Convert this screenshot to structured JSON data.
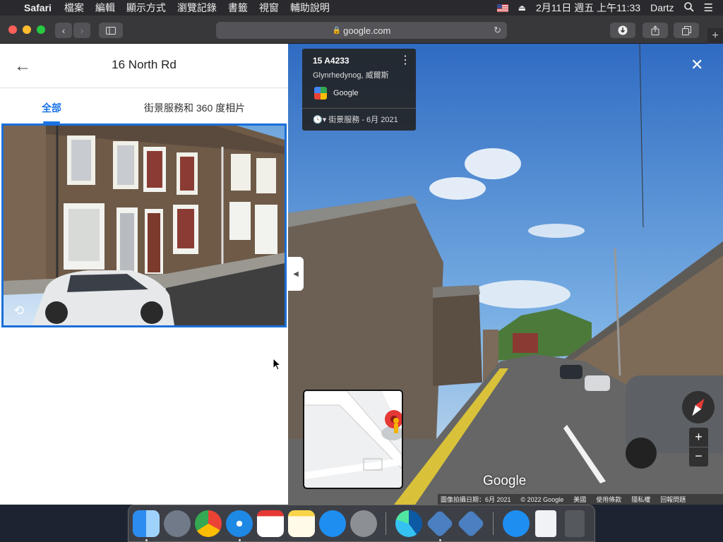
{
  "menubar": {
    "app_name": "Safari",
    "items": [
      "檔案",
      "編輯",
      "顯示方式",
      "瀏覽記錄",
      "書籤",
      "視窗",
      "輔助說明"
    ],
    "datetime": "2月11日 週五 上午11:33",
    "user": "Dartz"
  },
  "browser": {
    "url": "google.com"
  },
  "panel": {
    "title": "16 North Rd",
    "tabs": [
      {
        "label": "全部",
        "active": true
      },
      {
        "label": "街景服務和 360 度相片",
        "active": false
      }
    ]
  },
  "streetview": {
    "address": "15 A4233",
    "locality": "Glynrhedynog, 威爾斯",
    "provider": "Google",
    "history": "街景服務 - 6月 2021",
    "wordmark": "Google",
    "footer": [
      "圖像拍攝日期：6月 2021",
      "© 2022 Google",
      "美國",
      "使用條款",
      "隱私權",
      "回報問題"
    ]
  },
  "colors": {
    "accent": "#1a73e8",
    "menubar": "#2a2a2e",
    "toolbar": "#38383b"
  }
}
